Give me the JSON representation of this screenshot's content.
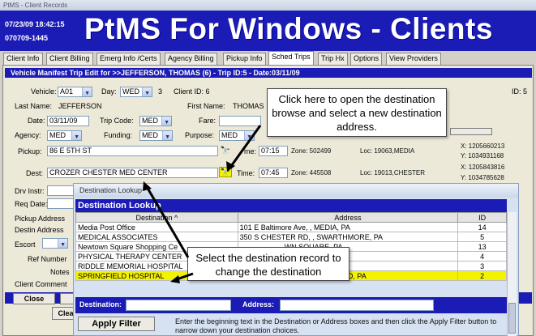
{
  "window": {
    "title": "PtMS - Client Records"
  },
  "header": {
    "date_time": "07/23/09  18:42:15",
    "code": "070709-1445",
    "app_title": "PtMS For Windows - Clients"
  },
  "tabs": [
    {
      "label": "Client Info"
    },
    {
      "label": "Client Billing"
    },
    {
      "label": "Emerg Info /Certs"
    },
    {
      "label": "Agency Billing"
    },
    {
      "label": "Pickup Info"
    },
    {
      "label": "Sched Trips"
    },
    {
      "label": "Trip Hx"
    },
    {
      "label": "Options"
    },
    {
      "label": "View Providers"
    }
  ],
  "form": {
    "title": "Vehicle Manifest Trip Edit for >>JEFFERSON, THOMAS (6) - Trip ID:5 - Date:03/11/09",
    "vehicle_label": "Vehicle:",
    "vehicle_value": "A01",
    "day_label": "Day:",
    "day_value": "WED",
    "day_number": "3",
    "client_id_label": "Client ID: 6",
    "id_right": "ID: 5",
    "last_name_label": "Last Name:",
    "last_name_value": "JEFFERSON",
    "first_name_label": "First Name:",
    "first_name_value": "THOMAS",
    "date_label": "Date:",
    "date_value": "03/11/09",
    "trip_code_label": "Trip Code:",
    "trip_code_value": "MED",
    "fare_label": "Fare:",
    "agency_label": "Agency:",
    "agency_value": "MED",
    "funding_label": "Funding:",
    "funding_value": "MED",
    "purpose_label": "Purpose:",
    "purpose_value": "MED",
    "pickup_label": "Pickup:",
    "pickup_value": "86 E 5TH ST",
    "pickup_time_label": "me:",
    "pickup_time_value": "07:15",
    "pickup_zone": "Zone: 502499",
    "pickup_loc": "Loc: 19063,MEDIA",
    "pickup_x": "X: 1205660213",
    "pickup_y": "Y: 1034931168",
    "dest_label": "Dest:",
    "dest_value": "CROZER CHESTER MED CENTER",
    "dest_time_label": "Time:",
    "dest_time_value": "07:45",
    "dest_zone": "Zone: 445508",
    "dest_loc": "Loc: 19013,CHESTER",
    "dest_x": "X: 1205843816",
    "dest_y": "Y: 1034785628",
    "drv_instr_label": "Drv Instr:",
    "req_date_label": "Req Date:",
    "pickup_address_label": "Pickup Address",
    "destin_address_label": "Destin Address",
    "escort_label": "Escort",
    "ref_number_label": "Ref Number",
    "notes_label": "Notes",
    "client_comment_label": "Client Comment",
    "close_button": "Close",
    "clear_button": "Clea"
  },
  "callouts": {
    "top": "Click here to open the destination browse and select a new destination address.",
    "bottom": "Select the destination record to change the destination"
  },
  "lookup": {
    "window_title": "Destination Lookup",
    "header": "Destination Lookup",
    "columns": {
      "destination": "Destination ^",
      "address": "Address",
      "id": "ID"
    },
    "rows": [
      {
        "destination": "Media Post Office",
        "address": "101 E Baltimore Ave, , MEDIA, PA",
        "id": "14"
      },
      {
        "destination": "MEDICAL ASSOCIATES",
        "address": "350 S CHESTER RD, , SWARTHMORE, PA",
        "id": "5"
      },
      {
        "destination": "Newtown Square Shopping Ce",
        "address": "                      WN SQUARE, PA",
        "id": "13"
      },
      {
        "destination": "PHYSICAL THERAPY CENTER",
        "address": "",
        "id": "4"
      },
      {
        "destination": "RIDDLE MEMORIAL HOSPITAL",
        "address": "",
        "id": "3"
      },
      {
        "destination": "SPRINGFIELD HOSPITAL",
        "address": "190 SPROUL RD, , SPRINGFIELD, PA",
        "id": "2"
      }
    ],
    "filter_destination_label": "Destination:",
    "filter_address_label": "Address:",
    "apply_filter_button": "Apply Filter",
    "hint": "Enter the beginning text in the Destination or Address boxes and then click the Apply Filter button to narrow down your destination choices."
  },
  "colors": {
    "header_blue": "#1b1bb5",
    "highlight_yellow": "#f3f300"
  }
}
